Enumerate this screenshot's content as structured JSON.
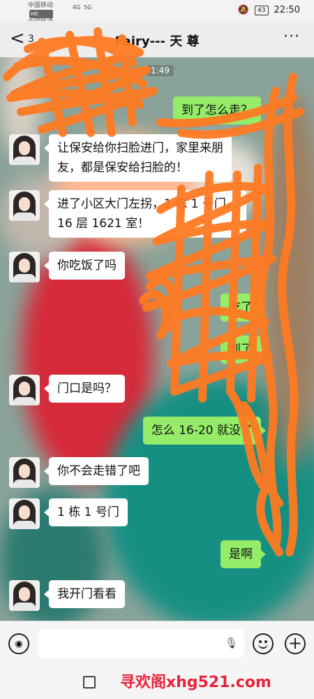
{
  "status_bar": {
    "carrier1": "中国移动",
    "carrier2": "中国联通",
    "hd": "HD",
    "net1": "4G",
    "net2": "5G",
    "battery": "43",
    "time": "22:50"
  },
  "header": {
    "back_count": "3",
    "title": "Fairy--- 天 尊",
    "more": "···"
  },
  "timestamp": "1:49",
  "messages": [
    {
      "from": "me",
      "lines": [
        "到了怎么走？"
      ]
    },
    {
      "from": "other",
      "lines": [
        "让保安给你扫脸进门，家里来朋",
        "友，都是保安给扫脸的！"
      ]
    },
    {
      "from": "other",
      "lines": [
        "进了小区大门左拐，1 栋 1 号门，",
        "16 层 1621 室！"
      ]
    },
    {
      "from": "other",
      "lines": [
        "你吃饭了吗"
      ]
    },
    {
      "from": "me",
      "lines": [
        "吃了"
      ]
    },
    {
      "from": "me",
      "lines": [
        "到了"
      ]
    },
    {
      "from": "other",
      "lines": [
        "门口是吗？"
      ]
    },
    {
      "from": "me",
      "lines": [
        "怎么 16-20 就没了"
      ]
    },
    {
      "from": "other",
      "lines": [
        "你不会走错了吧"
      ]
    },
    {
      "from": "other",
      "lines": [
        "1 栋 1 号门"
      ]
    },
    {
      "from": "me",
      "lines": [
        "是啊"
      ]
    },
    {
      "from": "other",
      "lines": [
        "我开门看看"
      ]
    }
  ],
  "input_bar": {
    "voice_icon": "voice-icon",
    "mic_icon": "mic-icon",
    "emoji_icon": "emoji-icon",
    "plus_icon": "plus-icon"
  },
  "watermark": "寻欢阁xhg521.com",
  "colors": {
    "outgoing_bubble": "#95ec69",
    "incoming_bubble": "#ffffff",
    "scribble": "#ff7a22"
  }
}
